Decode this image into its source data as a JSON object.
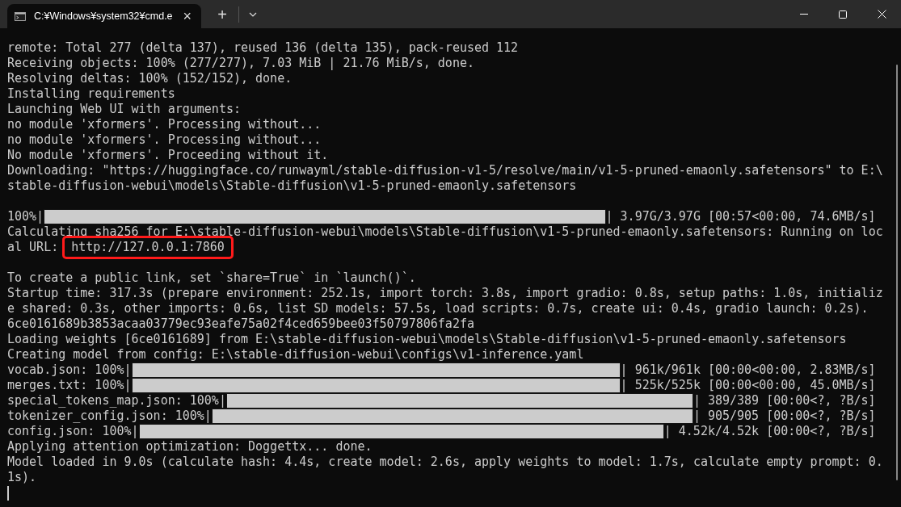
{
  "tab": {
    "title": "C:¥Windows¥system32¥cmd.e",
    "close": "×"
  },
  "new_tab": "+",
  "lines": [
    {
      "kind": "text",
      "text": "remote: Total 277 (delta 137), reused 136 (delta 135), pack-reused 112"
    },
    {
      "kind": "text",
      "text": "Receiving objects: 100% (277/277), 7.03 MiB | 21.76 MiB/s, done."
    },
    {
      "kind": "text",
      "text": "Resolving deltas: 100% (152/152), done."
    },
    {
      "kind": "text",
      "text": "Installing requirements"
    },
    {
      "kind": "text",
      "text": "Launching Web UI with arguments:"
    },
    {
      "kind": "text",
      "text": "no module 'xformers'. Processing without..."
    },
    {
      "kind": "text",
      "text": "no module 'xformers'. Processing without..."
    },
    {
      "kind": "text",
      "text": "No module 'xformers'. Proceeding without it."
    },
    {
      "kind": "text",
      "text": "Downloading: \"https://huggingface.co/runwayml/stable-diffusion-v1-5/resolve/main/v1-5-pruned-emaonly.safetensors\" to E:\\"
    },
    {
      "kind": "text",
      "text": "stable-diffusion-webui\\models\\Stable-diffusion\\v1-5-pruned-emaonly.safetensors"
    },
    {
      "kind": "blank"
    },
    {
      "kind": "progress",
      "prefix": "100%|",
      "level": 1,
      "suffix": "| 3.97G/3.97G [00:57<00:00, 74.6MB/s]"
    },
    {
      "kind": "text",
      "text": "Calculating sha256 for E:\\stable-diffusion-webui\\models\\Stable-diffusion\\v1-5-pruned-emaonly.safetensors: Running on loc"
    },
    {
      "kind": "highlight",
      "text": "al URL: ",
      "highlight": "http://127.0.0.1:7860"
    },
    {
      "kind": "blank"
    },
    {
      "kind": "text",
      "text": "To create a public link, set `share=True` in `launch()`."
    },
    {
      "kind": "text",
      "text": "Startup time: 317.3s (prepare environment: 252.1s, import torch: 3.8s, import gradio: 0.8s, setup paths: 1.0s, initializ"
    },
    {
      "kind": "text",
      "text": "e shared: 0.3s, other imports: 0.6s, list SD models: 57.5s, load scripts: 0.7s, create ui: 0.4s, gradio launch: 0.2s)."
    },
    {
      "kind": "text",
      "text": "6ce0161689b3853acaa03779ec93eafe75a02f4ced659bee03f50797806fa2fa"
    },
    {
      "kind": "text",
      "text": "Loading weights [6ce0161689] from E:\\stable-diffusion-webui\\models\\Stable-diffusion\\v1-5-pruned-emaonly.safetensors"
    },
    {
      "kind": "text",
      "text": "Creating model from config: E:\\stable-diffusion-webui\\configs\\v1-inference.yaml"
    },
    {
      "kind": "progress",
      "prefix": "vocab.json: 100%|",
      "level": 1,
      "suffix": "| 961k/961k [00:00<00:00, 2.83MB/s]"
    },
    {
      "kind": "progress",
      "prefix": "merges.txt: 100%|",
      "level": 1,
      "suffix": "| 525k/525k [00:00<00:00, 45.0MB/s]"
    },
    {
      "kind": "progress",
      "prefix": "special_tokens_map.json: 100%|",
      "level": 1,
      "suffix": "| 389/389 [00:00<?, ?B/s]"
    },
    {
      "kind": "progress",
      "prefix": "tokenizer_config.json: 100%|",
      "level": 1,
      "suffix": "| 905/905 [00:00<?, ?B/s]"
    },
    {
      "kind": "progress",
      "prefix": "config.json: 100%|",
      "level": 1,
      "suffix": "| 4.52k/4.52k [00:00<?, ?B/s]"
    },
    {
      "kind": "text",
      "text": "Applying attention optimization: Doggettx... done."
    },
    {
      "kind": "text",
      "text": "Model loaded in 9.0s (calculate hash: 4.4s, create model: 2.6s, apply weights to model: 1.7s, calculate empty prompt: 0."
    },
    {
      "kind": "text",
      "text": "1s)."
    },
    {
      "kind": "cursor"
    }
  ]
}
